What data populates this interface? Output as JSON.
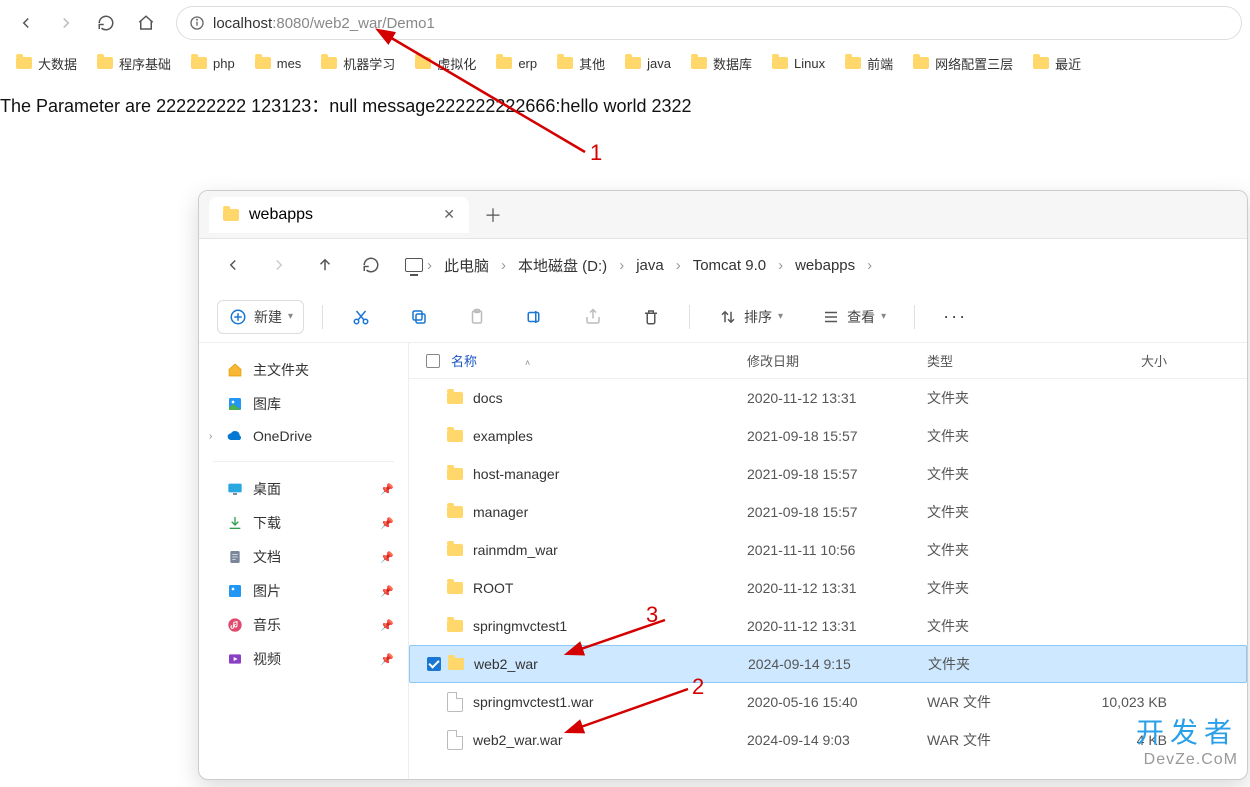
{
  "browser": {
    "url_host": "localhost",
    "url_rest": ":8080/web2_war/Demo1",
    "bookmarks": [
      "大数据",
      "程序基础",
      "php",
      "mes",
      "机器学习",
      "虚拟化",
      "erp",
      "其他",
      "java",
      "数据库",
      "Linux",
      "前端",
      "网络配置三层",
      "最近"
    ]
  },
  "page_text": "The Parameter are 222222222 123123：null message222222222666:hello world 2322",
  "annotations": {
    "a1": "1",
    "a2": "2",
    "a3": "3"
  },
  "explorer": {
    "tab_title": "webapps",
    "breadcrumb": [
      "此电脑",
      "本地磁盘 (D:)",
      "java",
      "Tomcat 9.0",
      "webapps"
    ],
    "toolbar": {
      "new": "新建",
      "sort": "排序",
      "view": "查看"
    },
    "sidebar": {
      "home": "主文件夹",
      "gallery": "图库",
      "onedrive": "OneDrive",
      "desktop": "桌面",
      "downloads": "下载",
      "documents": "文档",
      "pictures": "图片",
      "music": "音乐",
      "videos": "视频"
    },
    "columns": {
      "name": "名称",
      "date": "修改日期",
      "type": "类型",
      "size": "大小"
    },
    "rows": [
      {
        "icon": "folder",
        "name": "docs",
        "date": "2020-11-12 13:31",
        "type": "文件夹",
        "size": "",
        "selected": false
      },
      {
        "icon": "folder",
        "name": "examples",
        "date": "2021-09-18 15:57",
        "type": "文件夹",
        "size": "",
        "selected": false
      },
      {
        "icon": "folder",
        "name": "host-manager",
        "date": "2021-09-18 15:57",
        "type": "文件夹",
        "size": "",
        "selected": false
      },
      {
        "icon": "folder",
        "name": "manager",
        "date": "2021-09-18 15:57",
        "type": "文件夹",
        "size": "",
        "selected": false
      },
      {
        "icon": "folder",
        "name": "rainmdm_war",
        "date": "2021-11-11 10:56",
        "type": "文件夹",
        "size": "",
        "selected": false
      },
      {
        "icon": "folder",
        "name": "ROOT",
        "date": "2020-11-12 13:31",
        "type": "文件夹",
        "size": "",
        "selected": false
      },
      {
        "icon": "folder",
        "name": "springmvctest1",
        "date": "2020-11-12 13:31",
        "type": "文件夹",
        "size": "",
        "selected": false
      },
      {
        "icon": "folder",
        "name": "web2_war",
        "date": "2024-09-14 9:15",
        "type": "文件夹",
        "size": "",
        "selected": true
      },
      {
        "icon": "file",
        "name": "springmvctest1.war",
        "date": "2020-05-16 15:40",
        "type": "WAR 文件",
        "size": "10,023 KB",
        "selected": false
      },
      {
        "icon": "file",
        "name": "web2_war.war",
        "date": "2024-09-14 9:03",
        "type": "WAR 文件",
        "size": "4 KB",
        "selected": false
      }
    ]
  },
  "watermark": {
    "cn": "开发者",
    "en": "DevZe.CoM"
  }
}
